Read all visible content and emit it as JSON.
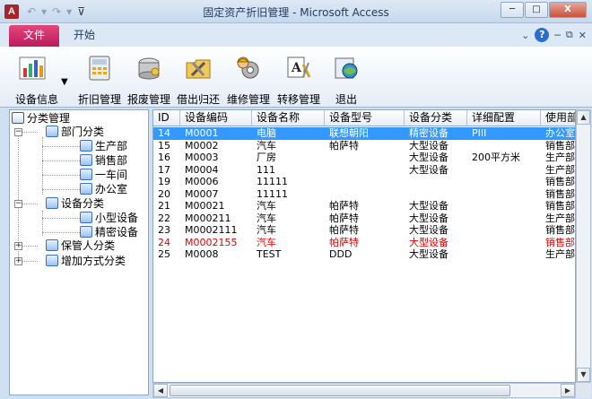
{
  "window": {
    "title": "固定资产折旧管理 - Microsoft Access",
    "minimize": "─",
    "restore": "□",
    "close": "X"
  },
  "ribbon_tabs": {
    "file": "文件",
    "home": "开始"
  },
  "ribbon_buttons": [
    {
      "label": "设备信息",
      "icon": "chart-icon"
    },
    {
      "label": "折旧管理",
      "icon": "calculator-icon"
    },
    {
      "label": "报废管理",
      "icon": "disk-drive-icon"
    },
    {
      "label": "借出归还",
      "icon": "folder-tools-icon"
    },
    {
      "label": "维修管理",
      "icon": "gear-worker-icon"
    },
    {
      "label": "转移管理",
      "icon": "text-tools-icon"
    },
    {
      "label": "退出",
      "icon": "exit-icon"
    }
  ],
  "tree": {
    "root": "分类管理",
    "dept": "部门分类",
    "dept_items": [
      "生产部",
      "销售部",
      "一车间",
      "办公室"
    ],
    "equip": "设备分类",
    "equip_items": [
      "小型设备",
      "精密设备"
    ],
    "keeper": "保管人分类",
    "addmode": "增加方式分类"
  },
  "table": {
    "headers": [
      "ID",
      "设备编码",
      "设备名称",
      "设备型号",
      "设备分类",
      "详细配置",
      "使用部"
    ],
    "rows": [
      [
        "14",
        "M0001",
        "电脑",
        "联想朝阳",
        "精密设备",
        "PIII",
        "办公室"
      ],
      [
        "15",
        "M0002",
        "汽车",
        "帕萨特",
        "大型设备",
        "",
        "销售部"
      ],
      [
        "16",
        "M0003",
        "厂房",
        "",
        "大型设备",
        "200平方米",
        "生产部"
      ],
      [
        "17",
        "M0004",
        "111",
        "",
        "大型设备",
        "",
        "生产部"
      ],
      [
        "19",
        "M0006",
        "11111",
        "",
        "",
        "",
        "销售部"
      ],
      [
        "20",
        "M0007",
        "11111",
        "",
        "",
        "",
        "销售部"
      ],
      [
        "21",
        "M00021",
        "汽车",
        "帕萨特",
        "大型设备",
        "",
        "销售部"
      ],
      [
        "22",
        "M000211",
        "汽车",
        "帕萨特",
        "大型设备",
        "",
        "生产部"
      ],
      [
        "23",
        "M0002111",
        "汽车",
        "帕萨特",
        "大型设备",
        "",
        "销售部"
      ],
      [
        "24",
        "M0002155",
        "汽车",
        "帕萨特",
        "大型设备",
        "",
        "销售部"
      ],
      [
        "25",
        "M0008",
        "TEST",
        "DDD",
        "大型设备",
        "",
        "生产部"
      ]
    ],
    "selected_row": 0,
    "highlight_row": 9,
    "highlight_color": "#e00000",
    "selected_color": "#3399ff"
  }
}
